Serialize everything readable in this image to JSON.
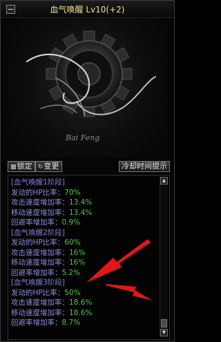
{
  "window": {
    "title": "血气唤醒 Lv10(+2)"
  },
  "art": {
    "logo_text": "Bai Feng"
  },
  "buttons": {
    "lock_label": "锁定",
    "change_label": "变更",
    "cooldown_label": "冷却时间提示"
  },
  "stages": [
    {
      "title": "[血气唤醒1阶段]",
      "stats": [
        {
          "label": "发动的HP比率：",
          "value": "70%"
        },
        {
          "label": "攻击速度增加率：",
          "value": "13.4%"
        },
        {
          "label": "移动速度增加率：",
          "value": "13.4%"
        },
        {
          "label": "回避率增加率：",
          "value": "0.9%"
        }
      ]
    },
    {
      "title": "[血气唤醒2阶段]",
      "stats": [
        {
          "label": "发动的HP比率：",
          "value": "60%"
        },
        {
          "label": "攻击速度增加率：",
          "value": "16%"
        },
        {
          "label": "移动速度增加率：",
          "value": "16%"
        },
        {
          "label": "回避率增加率：",
          "value": "5.2%"
        }
      ]
    },
    {
      "title": "[血气唤醒3阶段]",
      "stats": [
        {
          "label": "发动的HP比率：",
          "value": "50%"
        },
        {
          "label": "攻击速度增加率：",
          "value": "18.6%"
        },
        {
          "label": "移动速度增加率：",
          "value": "18.6%"
        },
        {
          "label": "回避率增加率：",
          "value": "8.7%"
        }
      ]
    }
  ],
  "colors": {
    "title": "#f0e090",
    "stage_title": "#7f7fd6",
    "stat_label": "#8d8de0",
    "stat_value": "#52c64c",
    "annotation_arrow": "#e01818"
  }
}
